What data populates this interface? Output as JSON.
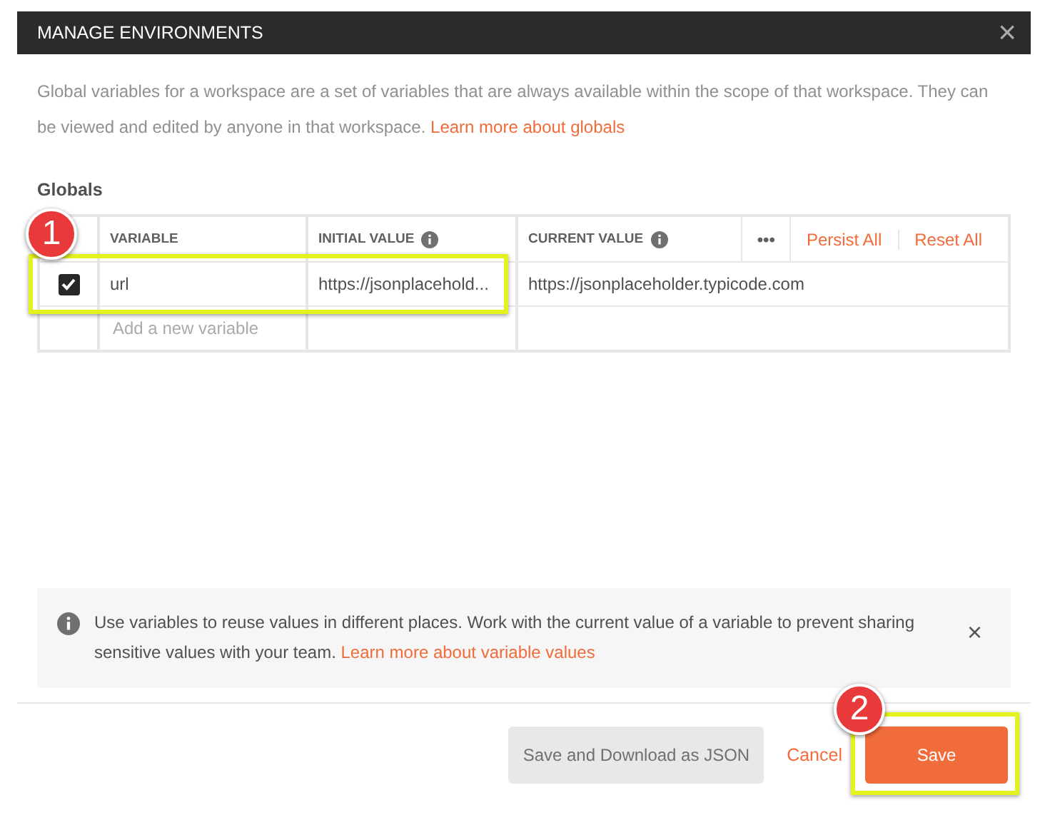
{
  "dialog": {
    "title": "MANAGE ENVIRONMENTS",
    "close": "×"
  },
  "description": {
    "text": "Global variables for a workspace are a set of variables that are always available within the scope of that workspace. They can be viewed and edited by anyone in that workspace.",
    "link": "Learn more about globals"
  },
  "section_title": "Globals",
  "table": {
    "columns": [
      {
        "label": "VARIABLE",
        "info": false
      },
      {
        "label": "INITIAL VALUE",
        "info": true
      },
      {
        "label": "CURRENT VALUE",
        "info": true
      }
    ],
    "more": "•••",
    "persist_all": "Persist All",
    "reset_all": "Reset All",
    "rows": [
      {
        "checked": true,
        "variable": "url",
        "initial_value": "https://jsonplacehold...",
        "current_value": "https://jsonplaceholder.typicode.com"
      }
    ],
    "new_row_placeholder": "Add a new variable"
  },
  "info_box": {
    "text": "Use variables to reuse values in different places. Work with the current value of a variable to prevent sharing sensitive values with your team.",
    "link": "Learn more about variable values",
    "close": "×"
  },
  "buttons": [
    {
      "kind": "secondary",
      "label": "Save and Download as JSON"
    },
    {
      "kind": "link",
      "label": "Cancel"
    },
    {
      "kind": "primary",
      "label": "Save",
      "callout": "2"
    }
  ],
  "callouts": [
    {
      "number": "1"
    }
  ]
}
